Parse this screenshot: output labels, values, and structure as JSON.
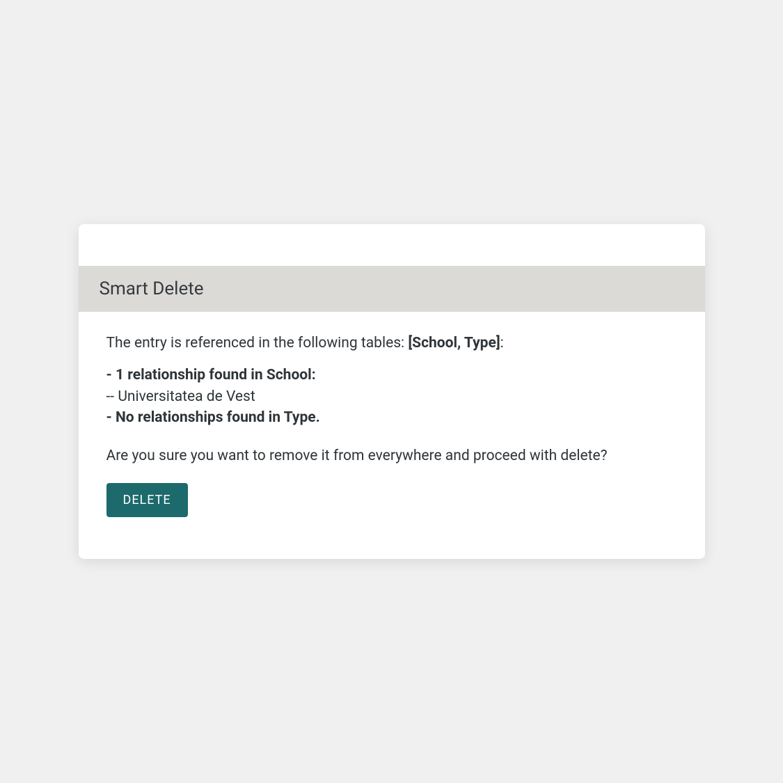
{
  "header": {
    "title": "Smart Delete"
  },
  "body": {
    "intro_prefix": "The entry is referenced in the following tables: ",
    "intro_tables": "[School, Type]",
    "intro_suffix": ":",
    "relationships": {
      "line1": "- 1 relationship found in School:",
      "line2": "-- Universitatea de Vest",
      "line3": "- No relationships found in Type."
    },
    "confirm": "Are you sure you want to remove it from everywhere and proceed with delete?",
    "delete_label": "DELETE"
  },
  "colors": {
    "header_bg": "#dcdad7",
    "button_bg": "#1d6a6c",
    "text": "#2e3438"
  }
}
